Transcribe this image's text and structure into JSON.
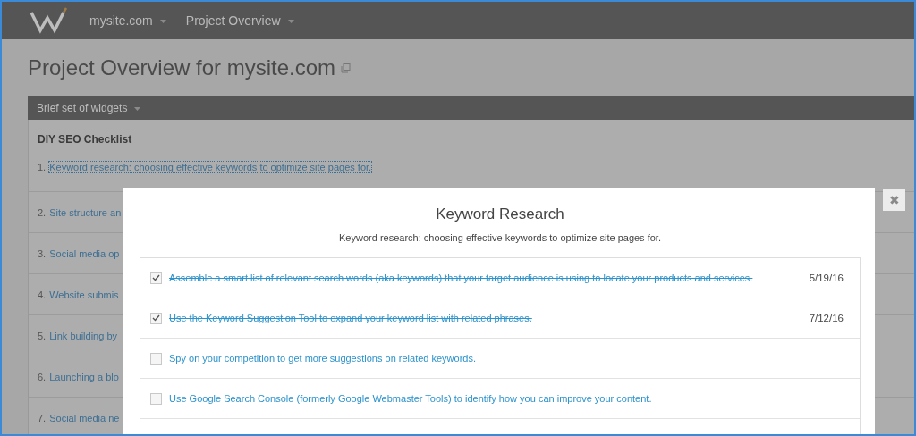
{
  "top_bar": {
    "site_menu": "mysite.com",
    "page_menu": "Project Overview"
  },
  "page_title": "Project Overview for mysite.com",
  "widget_bar": {
    "label": "Brief set of widgets"
  },
  "checklist": {
    "title": "DIY SEO Checklist",
    "items": [
      {
        "number": "1.",
        "text": "Keyword research: choosing effective keywords to optimize site pages for.",
        "selected": true
      },
      {
        "number": "2.",
        "text": "Site structure an",
        "selected": false
      },
      {
        "number": "3.",
        "text": "Social media op",
        "selected": false
      },
      {
        "number": "4.",
        "text": "Website submis",
        "selected": false
      },
      {
        "number": "5.",
        "text": "Link building by",
        "selected": false
      },
      {
        "number": "6.",
        "text": "Launching a blo",
        "selected": false
      },
      {
        "number": "7.",
        "text": "Social media ne",
        "selected": false
      }
    ]
  },
  "modal": {
    "title": "Keyword Research",
    "subtitle": "Keyword research: choosing effective keywords to optimize site pages for.",
    "close": "✖",
    "tasks": [
      {
        "text": "Assemble a smart list of relevant search words (aka keywords) that your target audience is using to locate your products and services.",
        "checked": true,
        "date": "5/19/16"
      },
      {
        "text": "Use the Keyword Suggestion Tool to expand your keyword list with related phrases.",
        "checked": true,
        "date": "7/12/16"
      },
      {
        "text": "Spy on your competition to get more suggestions on related keywords.",
        "checked": false
      },
      {
        "text": "Use Google Search Console (formerly Google Webmaster Tools) to identify how you can improve your content.",
        "checked": false
      }
    ]
  }
}
